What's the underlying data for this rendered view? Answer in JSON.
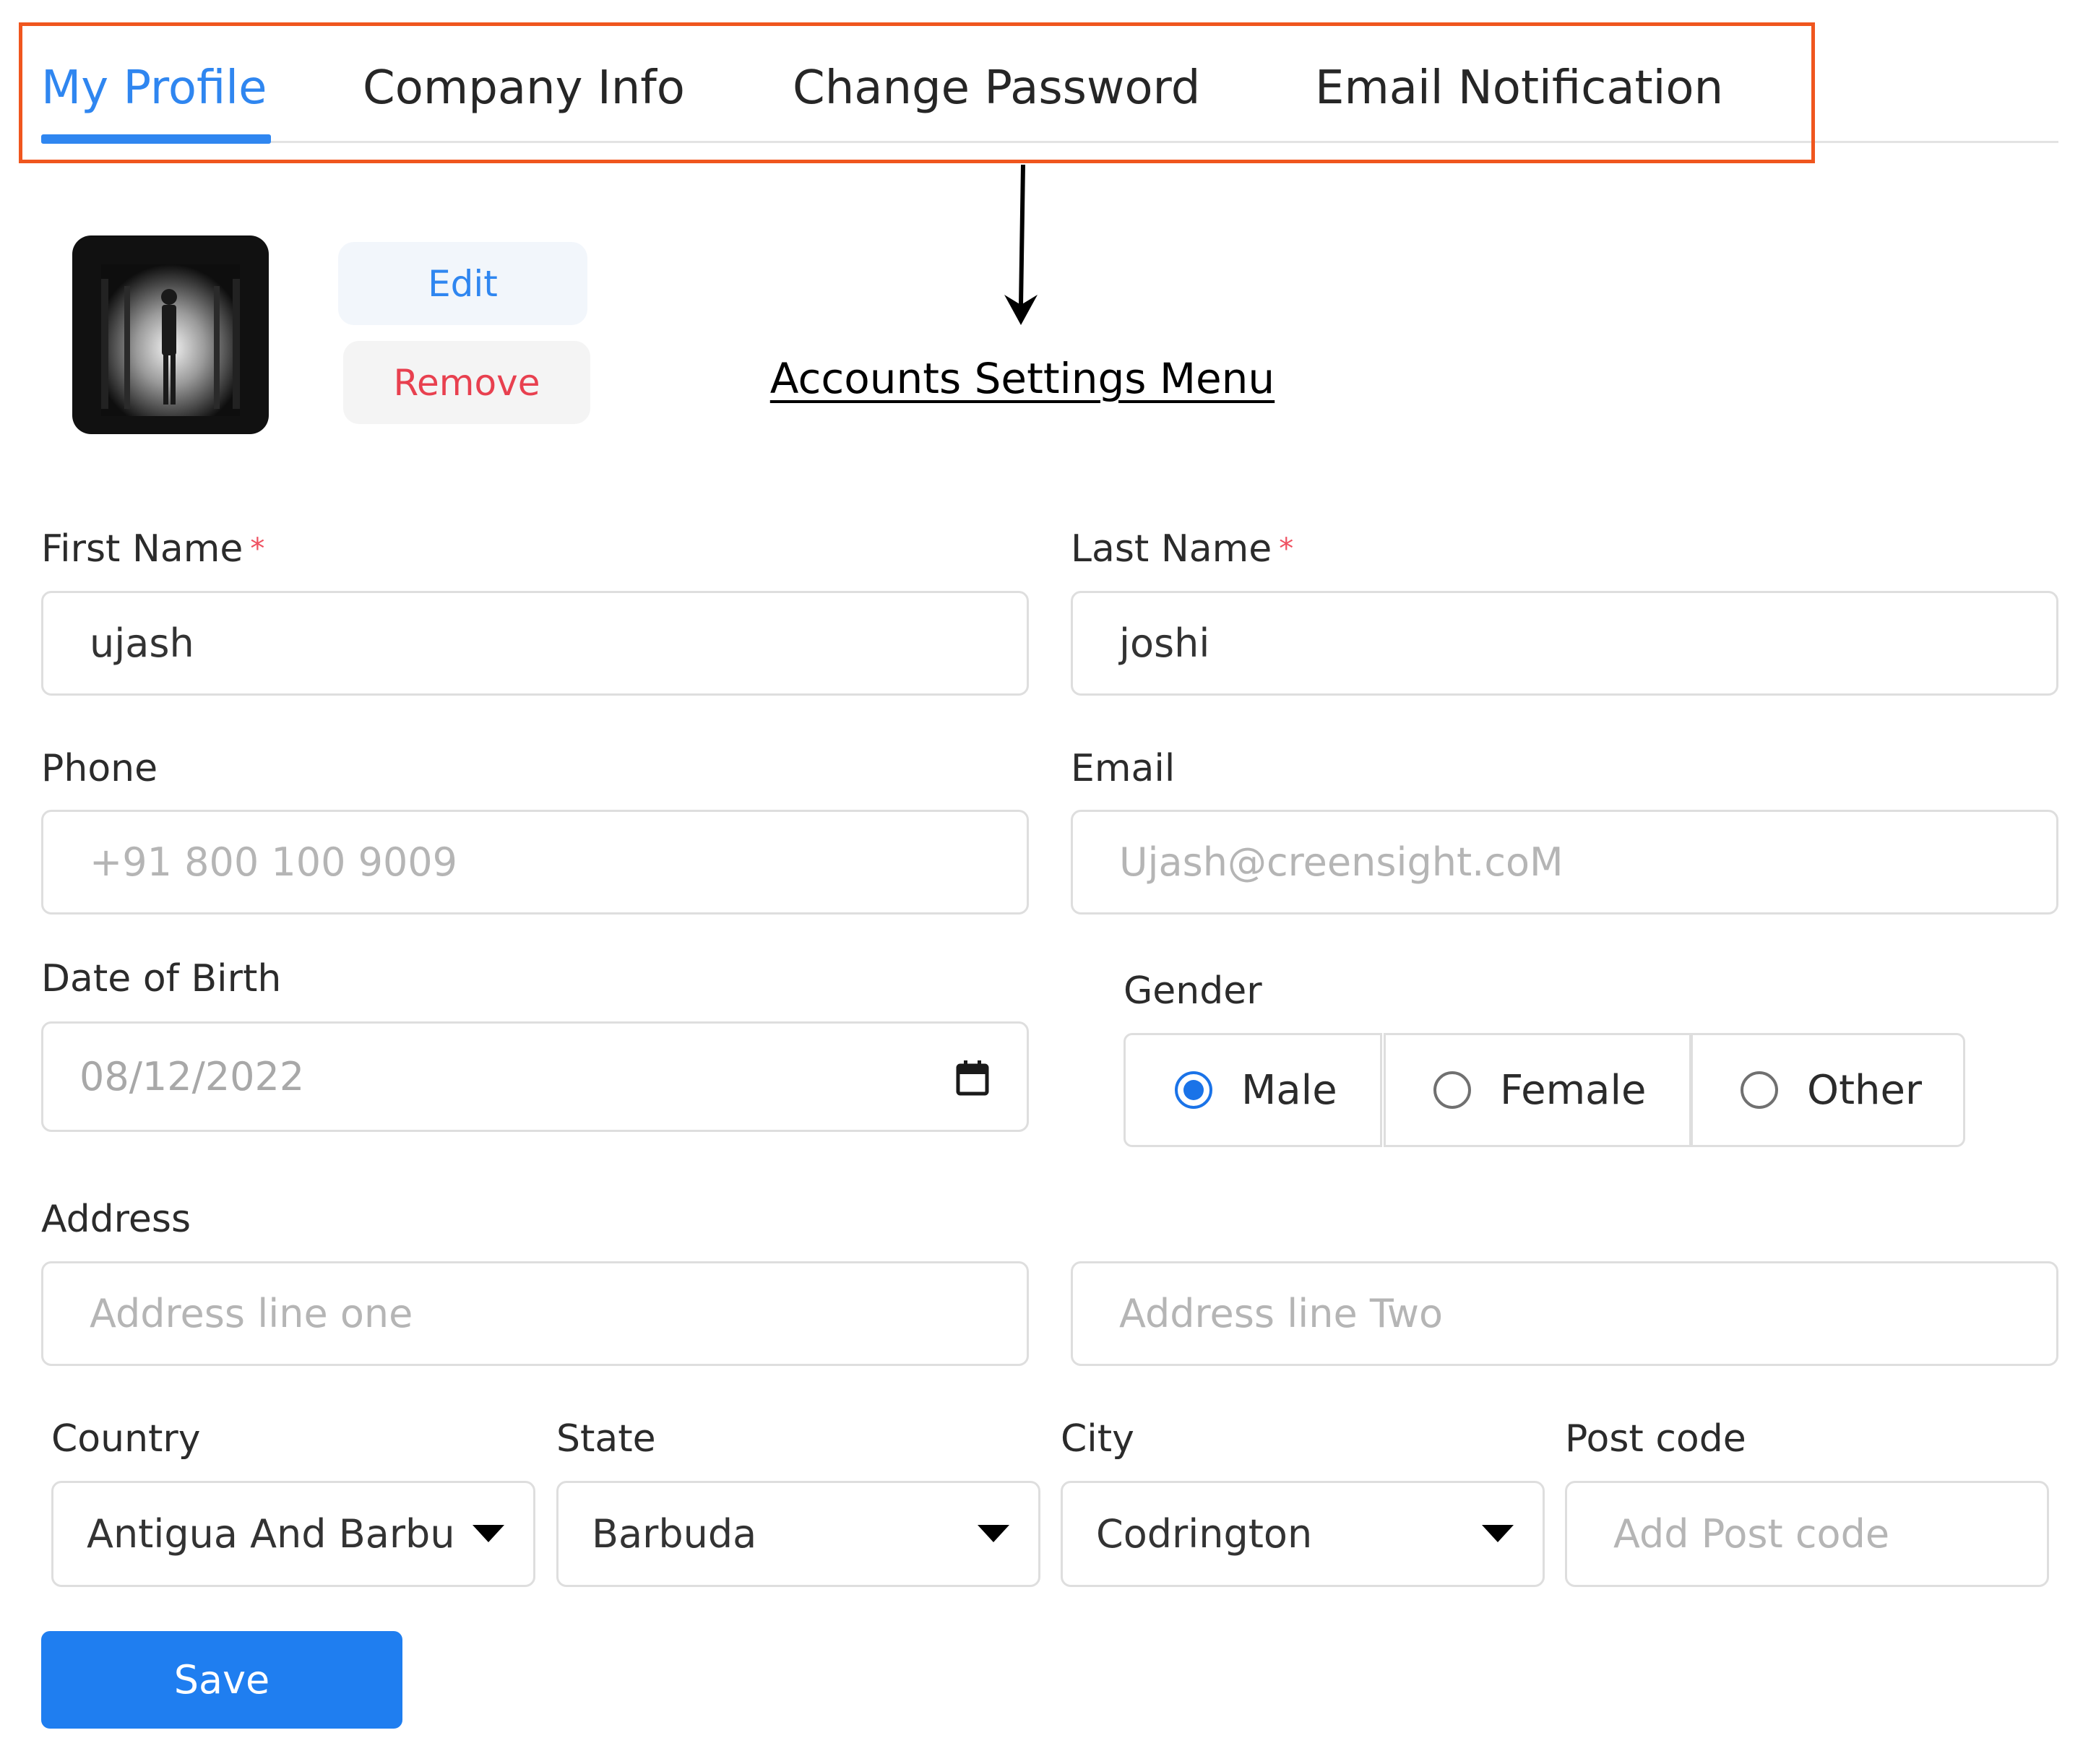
{
  "tabs": [
    {
      "label": "My Profile",
      "active": true
    },
    {
      "label": "Company Info",
      "active": false
    },
    {
      "label": "Change Password",
      "active": false
    },
    {
      "label": "Email Notification",
      "active": false
    }
  ],
  "annotation": {
    "text": "Accounts Settings Menu"
  },
  "avatar": {
    "edit_label": "Edit",
    "remove_label": "Remove"
  },
  "form": {
    "first_name": {
      "label": "First Name",
      "required_mark": "*",
      "value": "ujash"
    },
    "last_name": {
      "label": "Last Name",
      "required_mark": "*",
      "value": "joshi"
    },
    "phone": {
      "label": "Phone",
      "placeholder": "+91 800 100 9009"
    },
    "email": {
      "label": "Email",
      "placeholder": "Ujash@creensight.coM"
    },
    "dob": {
      "label": "Date of Birth",
      "value": "08/12/2022"
    },
    "gender": {
      "label": "Gender",
      "options": [
        {
          "label": "Male",
          "checked": true
        },
        {
          "label": "Female",
          "checked": false
        },
        {
          "label": "Other",
          "checked": false
        }
      ]
    },
    "address": {
      "label": "Address",
      "line1_placeholder": "Address line one",
      "line2_placeholder": "Address line Two"
    },
    "country": {
      "label": "Country",
      "value": "Antigua And Barbuda"
    },
    "state": {
      "label": "State",
      "value": "Barbuda"
    },
    "city": {
      "label": "City",
      "value": "Codrington"
    },
    "postcode": {
      "label": "Post code",
      "placeholder": "Add Post code"
    },
    "save_label": "Save"
  },
  "colors": {
    "accent": "#2f86f0",
    "highlight_border": "#f0561e",
    "remove_text": "#e8404f",
    "required": "#ef5161"
  }
}
